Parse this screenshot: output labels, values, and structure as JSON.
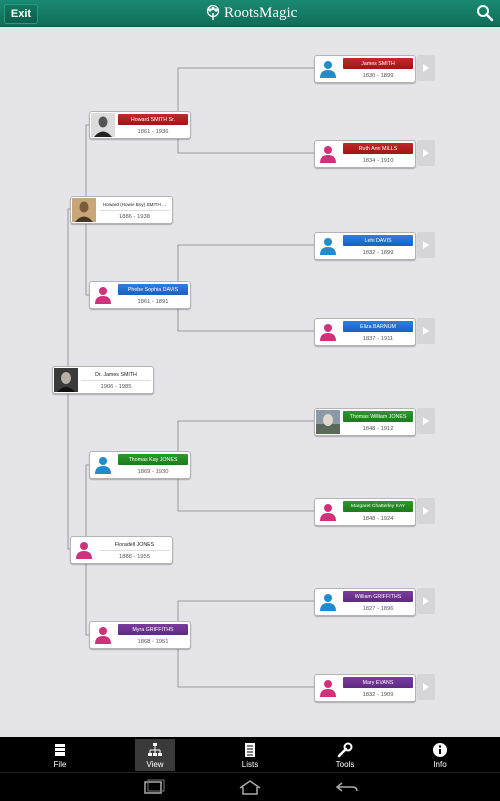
{
  "topbar": {
    "exit_label": "Exit",
    "app_name": "RootsMagic"
  },
  "people": {
    "p1": {
      "name": "Dr. James SMITH",
      "dates": "1906 - 1985"
    },
    "p2": {
      "name": "Howard (Howie Boy) SMITH ...",
      "dates": "1886 - 1938"
    },
    "p3": {
      "name": "Floradell JONES",
      "dates": "1888 - 1955"
    },
    "p4": {
      "name": "Howard SMITH Sr.",
      "dates": "1861 - 1936"
    },
    "p5": {
      "name": "Phebe Sophia DAVIS",
      "dates": "1861 - 1891"
    },
    "p6": {
      "name": "Thomas Kay JONES",
      "dates": "1869 - 1930"
    },
    "p7": {
      "name": "Myra GRIFFITHS",
      "dates": "1868 - 1951"
    },
    "p8": {
      "name": "James SMITH",
      "dates": "1830 - 1899"
    },
    "p9": {
      "name": "Ruth Ann MILLS",
      "dates": "1834 - 1910"
    },
    "p10": {
      "name": "Lehi DAVIS",
      "dates": "1832 - 1899"
    },
    "p11": {
      "name": "Eliza BARNUM",
      "dates": "1837 - 1911"
    },
    "p12": {
      "name": "Thomas William JONES",
      "dates": "1848 - 1912"
    },
    "p13": {
      "name": "Margaret Chatterley KAY",
      "dates": "1848 - 1924"
    },
    "p14": {
      "name": "William GRIFFITHS",
      "dates": "1827 - 1896"
    },
    "p15": {
      "name": "Mary EVANS",
      "dates": "1832 - 1909"
    }
  },
  "colors": {
    "accent": "#0f6d58",
    "male_header": "#1a5fc2",
    "female_header": "#a01616",
    "jones_line": "#1e7a1e",
    "griffiths_line": "#5e2a80"
  },
  "tabs": [
    {
      "label": "File",
      "icon": "file-icon"
    },
    {
      "label": "View",
      "icon": "pedigree-icon",
      "active": true
    },
    {
      "label": "Lists",
      "icon": "list-icon"
    },
    {
      "label": "Tools",
      "icon": "wrench-icon"
    },
    {
      "label": "Info",
      "icon": "info-icon"
    }
  ]
}
